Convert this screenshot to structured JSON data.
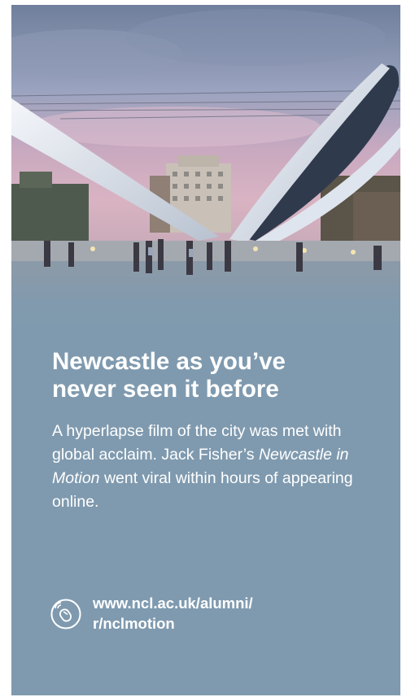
{
  "article": {
    "headline_line1": "Newcastle as you’ve",
    "headline_line2": "never seen it before",
    "body_part1": "A hyperlapse film of the city was met with global acclaim. Jack Fisher’s ",
    "body_italic": "Newcastle in Motion",
    "body_part2": " went viral within hours of appearing online.",
    "link_line1": "www.ncl.ac.uk/alumni/",
    "link_line2": "r/nclmotion",
    "link_icon": "mouse-click-icon"
  },
  "colors": {
    "card_background": "#7f9aaf",
    "text": "#ffffff"
  }
}
